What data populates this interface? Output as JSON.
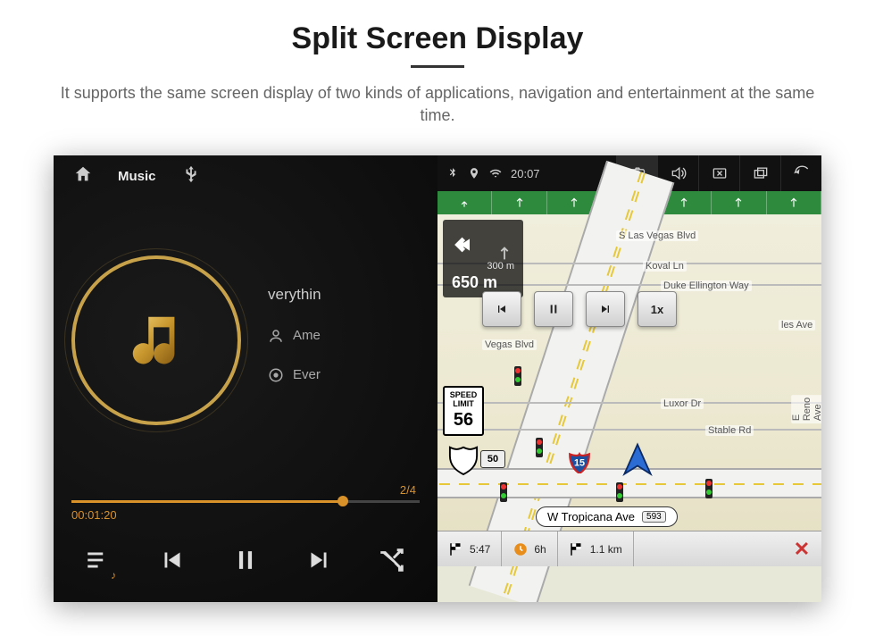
{
  "header": {
    "title": "Split Screen Display",
    "subtitle": "It supports the same screen display of two kinds of applications, navigation and entertainment at the same time."
  },
  "music": {
    "app_label": "Music",
    "track_title": "verythin",
    "artist": "Ame",
    "album": "Ever",
    "track_index": "2/4",
    "elapsed": "00:01:20",
    "progress_pct": 78
  },
  "status": {
    "time": "20:07"
  },
  "nav": {
    "turn_next_m": "300 m",
    "turn_dist": "650 m",
    "speed_limit_label": "SPEED LIMIT",
    "speed_limit": "56",
    "route_shield": "50",
    "interstate": "15",
    "playback_speed": "1x",
    "street_name": "W Tropicana Ave",
    "street_ref": "593",
    "labels": {
      "lasvegas": "S Las Vegas Blvd",
      "koval": "Koval Ln",
      "duke": "Duke Ellington Way",
      "luxor": "Luxor Dr",
      "stable": "Stable Rd",
      "reno": "E Reno Ave",
      "vegas_blvd": "Vegas Blvd",
      "les": "les Ave"
    },
    "bottom": {
      "eta": "5:47",
      "hours": "6h",
      "dist": "1.1 km"
    }
  }
}
